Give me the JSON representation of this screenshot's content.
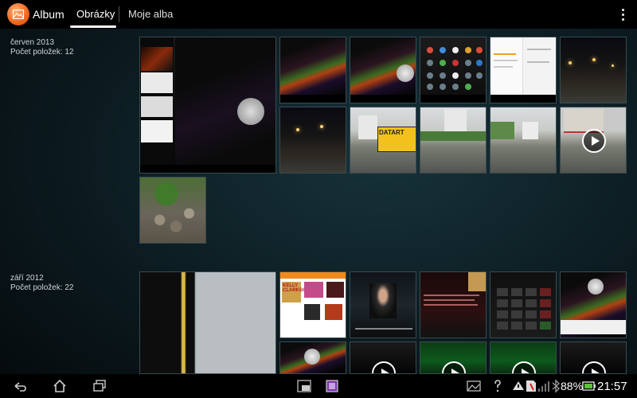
{
  "app": {
    "title": "Album",
    "tabs": [
      {
        "label": "Obrázky",
        "active": true
      },
      {
        "label": "Moje alba",
        "active": false
      }
    ]
  },
  "sections": [
    {
      "date": "červen 2013",
      "count_label": "Počet položek: 12"
    },
    {
      "date": "září 2012",
      "count_label": "Počet položek: 22"
    }
  ],
  "overlays": {
    "truck_sign": "DATART",
    "music_title": "KELLY CLARKSON"
  },
  "status_bar": {
    "battery": "88%",
    "time": "21:57"
  },
  "colors": {
    "accent": "#f0651c",
    "topbar": "#000000",
    "background": "#0d1f25"
  },
  "icons": {
    "back": "back-icon",
    "home": "home-icon",
    "recent": "recent-apps-icon",
    "overflow": "overflow-menu-icon"
  }
}
